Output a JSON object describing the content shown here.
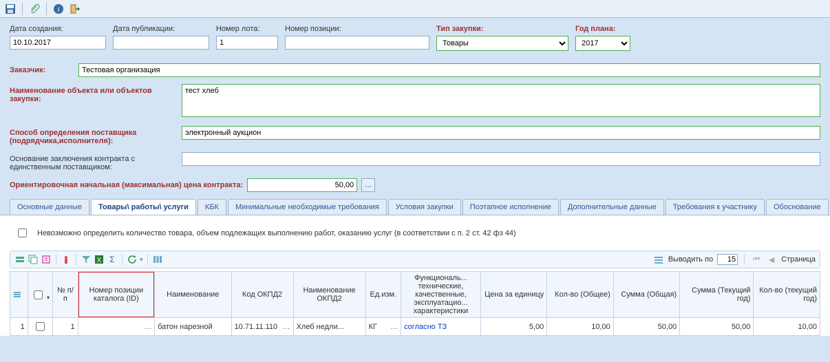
{
  "toolbar": {
    "save": "save-icon",
    "attach": "attach-icon",
    "info": "info-icon",
    "exit": "exit-icon"
  },
  "form": {
    "date_created_label": "Дата создания:",
    "date_created": "10.10.2017",
    "date_pub_label": "Дата публикации:",
    "date_pub": "",
    "lot_no_label": "Номер лота:",
    "lot_no": "1",
    "pos_no_label": "Номер позиции:",
    "pos_no": "",
    "ptype_label": "Тип закупки:",
    "ptype": "Товары",
    "pyear_label": "Год плана:",
    "pyear": "2017",
    "customer_label": "Заказчик:",
    "customer": "Тестовая организация",
    "obj_label": "Наименование объекта или объектов закупки:",
    "obj": "тест хлеб",
    "supplier_label": "Способ определения поставщика (подрядчика,исполнителя):",
    "supplier": "электронный аукцион",
    "basis_label": "Основание заключения контракта с единственным поставщиком:",
    "basis": "",
    "price_label": "Ориентировочная начальная (максимальная) цена контракта:",
    "price": "50,00"
  },
  "tabs": [
    "Основные данные",
    "Товары\\ работы\\ услуги",
    "КБК",
    "Минимальные необходимые требования",
    "Условия закупки",
    "Поэтапное исполнение",
    "Дополнительные данные",
    "Требования к участнику",
    "Обоснование"
  ],
  "active_tab": 1,
  "checkbox_line": "Невозможно определить количество товара, объем подлежащих выполнению работ, оказанию услуг (в соответствии с п. 2 ст. 42 фз 44)",
  "grid_tools": {
    "output_label": "Выводить по",
    "output_value": "15",
    "page_label": "Страница"
  },
  "grid_cols": [
    "",
    "",
    "№ п/п",
    "Номер позиции каталога (ID)",
    "Наименование",
    "Код ОКПД2",
    "Наименование ОКПД2",
    "Ед.изм.",
    "Функциональ... технические, качественные, эксплуатацио... характеристики",
    "Цена за единицу",
    "Кол-во (Общее)",
    "Сумма (Общая)",
    "Сумма (Текущий год)",
    "Кол-во (текущий год)"
  ],
  "grid_row": {
    "rownum": "1",
    "chk": false,
    "npp": "1",
    "catalog_id": "",
    "name": "батон нарезной",
    "okpd2_code": "10.71.11.110",
    "okpd2_name": "Хлеб недли...",
    "unit": "КГ",
    "chars": "согласно ТЗ",
    "price": "5,00",
    "qty_total": "10,00",
    "sum_total": "50,00",
    "sum_year": "50,00",
    "qty_year": "10,00"
  }
}
